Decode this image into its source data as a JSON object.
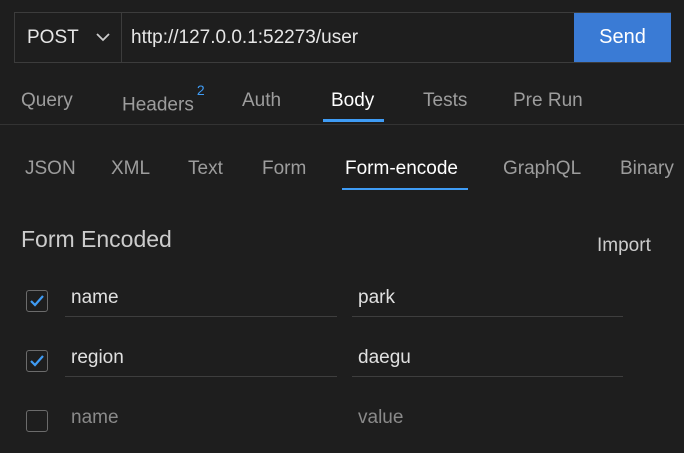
{
  "request": {
    "method": "POST",
    "url": "http://127.0.0.1:52273/user",
    "send_label": "Send"
  },
  "main_tabs": [
    {
      "label": "Query"
    },
    {
      "label": "Headers",
      "badge": "2"
    },
    {
      "label": "Auth"
    },
    {
      "label": "Body",
      "active": true
    },
    {
      "label": "Tests"
    },
    {
      "label": "Pre Run"
    }
  ],
  "body_tabs": [
    {
      "label": "JSON"
    },
    {
      "label": "XML"
    },
    {
      "label": "Text"
    },
    {
      "label": "Form"
    },
    {
      "label": "Form-encode",
      "active": true
    },
    {
      "label": "GraphQL"
    },
    {
      "label": "Binary"
    }
  ],
  "form": {
    "title": "Form Encoded",
    "import_label": "Import",
    "rows": [
      {
        "checked": true,
        "key": "name",
        "value": "park"
      },
      {
        "checked": true,
        "key": "region",
        "value": "daegu"
      }
    ],
    "new_row": {
      "checked": false,
      "key_placeholder": "name",
      "value_placeholder": "value"
    }
  },
  "colors": {
    "accent": "#3a7bd5",
    "tab_active_underline": "#3f9cf5",
    "background": "#1e1e1e"
  },
  "icons": {
    "method_dropdown": "chevron-down-icon",
    "checkbox_checked": "checkmark-icon"
  }
}
